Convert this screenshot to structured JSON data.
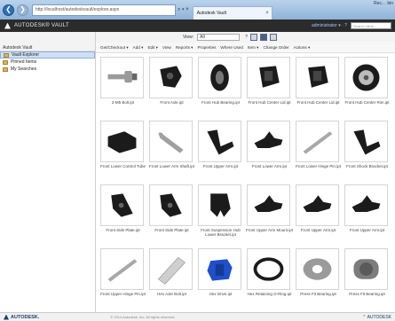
{
  "browser": {
    "back_glyph": "❮",
    "forward_glyph": "❯",
    "address": "http://localhost/autodeskvault/explore.aspx",
    "address_controls": "⌕ ▾ ×",
    "tab_title": "Autodesk Vault",
    "tab_close": "×",
    "desktop_text": "Rec…\nbin"
  },
  "app": {
    "title": "AUTODESK® VAULT",
    "user": "administrator ▾ · ?",
    "search_placeholder": "Search Vault..."
  },
  "toolbar": {
    "view_label": "View:",
    "view_value": "All",
    "help": "?",
    "items": [
      "Get/Checkout ▾",
      "Add ▾",
      "Edit ▾",
      "View",
      "Reports ▾",
      "Properties",
      "Where Used",
      "Item ▾",
      "Change Order",
      "Actions ▾"
    ]
  },
  "sidebar": {
    "header": "Autodesk Vault",
    "items": [
      {
        "label": "Vault Explorer",
        "selected": true
      },
      {
        "label": "Pinned Items",
        "selected": false
      },
      {
        "label": "My Searches",
        "selected": false
      }
    ]
  },
  "grid": {
    "items": [
      {
        "label": "2-M5 Bolt.ipt",
        "icon": "bolt-icon",
        "color": "#9a9a9a"
      },
      {
        "label": "Front Axle.ipt",
        "icon": "axle-icon",
        "color": "#1b1b1b"
      },
      {
        "label": "Front Hub Bearing.ipt",
        "icon": "bearing-icon",
        "color": "#1b1b1b"
      },
      {
        "label": "Front Hub Center Lid.ipt",
        "icon": "hub-icon",
        "color": "#1b1b1b"
      },
      {
        "label": "Front Hub Center Lid.ipt",
        "icon": "hub-icon",
        "color": "#1b1b1b"
      },
      {
        "label": "Front Hub Center Rim.ipt",
        "icon": "wheel-icon",
        "color": "#1b1b1b"
      },
      {
        "label": "Front Lower Control Tube",
        "icon": "block-icon",
        "color": "#1b1b1b"
      },
      {
        "label": "Front Lower Arm Shaft.ipt",
        "icon": "rod-icon",
        "color": "#a0a0a0"
      },
      {
        "label": "Front Upper Arm.ipt",
        "icon": "bracket-icon",
        "color": "#1b1b1b"
      },
      {
        "label": "Front Lower Arm.ipt",
        "icon": "arm-icon",
        "color": "#1b1b1b"
      },
      {
        "label": "Front Lower Hinge Pin.ipt",
        "icon": "pin-icon",
        "color": "#a8a8a8"
      },
      {
        "label": "Front Shock Bracket.ipt",
        "icon": "bracket-icon",
        "color": "#1b1b1b"
      },
      {
        "label": "Front Side Plate.ipt",
        "icon": "plate-icon",
        "color": "#1b1b1b"
      },
      {
        "label": "Front Side Plate.ipt",
        "icon": "plate-icon",
        "color": "#1b1b1b"
      },
      {
        "label": "Front Suspension Hub Lower Bracket.ipt",
        "icon": "clamp-icon",
        "color": "#1b1b1b"
      },
      {
        "label": "Front Upper Arm Mount.ipt",
        "icon": "arm-icon",
        "color": "#1b1b1b"
      },
      {
        "label": "Front Upper Arm.ipt",
        "icon": "arm-icon",
        "color": "#1b1b1b"
      },
      {
        "label": "Front Upper Arm.ipt",
        "icon": "arm-icon",
        "color": "#1b1b1b"
      },
      {
        "label": "Front Upper Hinge Pin.ipt",
        "icon": "pin-icon",
        "color": "#a8a8a8"
      },
      {
        "label": "Hex Axle Bolt.ipt",
        "icon": "tube-icon",
        "color": "#cfcfcf"
      },
      {
        "label": "Hex Drive.ipt",
        "icon": "hexdrive-icon",
        "color": "#1f4fc9"
      },
      {
        "label": "Hex Retaining O-Ring.ipt",
        "icon": "oring-icon",
        "color": "#1b1b1b"
      },
      {
        "label": "Press Fit Bearing.ipt",
        "icon": "washer-icon",
        "color": "#9a9a9a"
      },
      {
        "label": "Press Fit Bearing.ipt",
        "icon": "cylinder-icon",
        "color": "#7c7c7c"
      }
    ]
  },
  "footer": {
    "brand": "AUTODESK.",
    "copyright": "© 2014 Autodesk, Inc. All rights reserved.",
    "right": "⌃ AUTODESK"
  }
}
